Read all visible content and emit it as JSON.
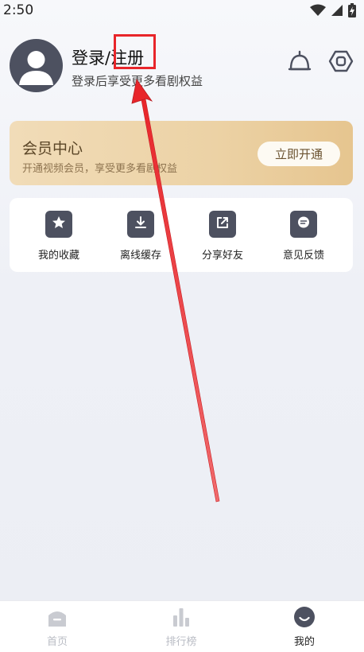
{
  "status_bar": {
    "time": "2:50",
    "icons": [
      "wifi-icon",
      "signal-icon",
      "battery-charging-icon"
    ]
  },
  "profile": {
    "title_prefix": "登录/",
    "title_highlight": "注册",
    "subtitle": "登录后享受更多看剧权益",
    "avatar_icon": "user-avatar-icon"
  },
  "header_icons": [
    "notification-bell-icon",
    "settings-hexagon-icon"
  ],
  "vip": {
    "title": "会员中心",
    "subtitle": "开通视频会员，享受更多看剧权益",
    "button_label": "立即开通"
  },
  "shortcuts": [
    {
      "label": "我的收藏",
      "icon": "star-icon"
    },
    {
      "label": "离线缓存",
      "icon": "download-icon"
    },
    {
      "label": "分享好友",
      "icon": "share-icon"
    },
    {
      "label": "意见反馈",
      "icon": "feedback-icon"
    }
  ],
  "bottom_nav": [
    {
      "label": "首页",
      "icon": "home-icon",
      "active": false
    },
    {
      "label": "排行榜",
      "icon": "ranking-icon",
      "active": false
    },
    {
      "label": "我的",
      "icon": "mine-icon",
      "active": true
    }
  ],
  "colors": {
    "accent_dark": "#4d5160",
    "vip_gold": "#ecd2a5",
    "annotation_red": "#e8252a"
  }
}
